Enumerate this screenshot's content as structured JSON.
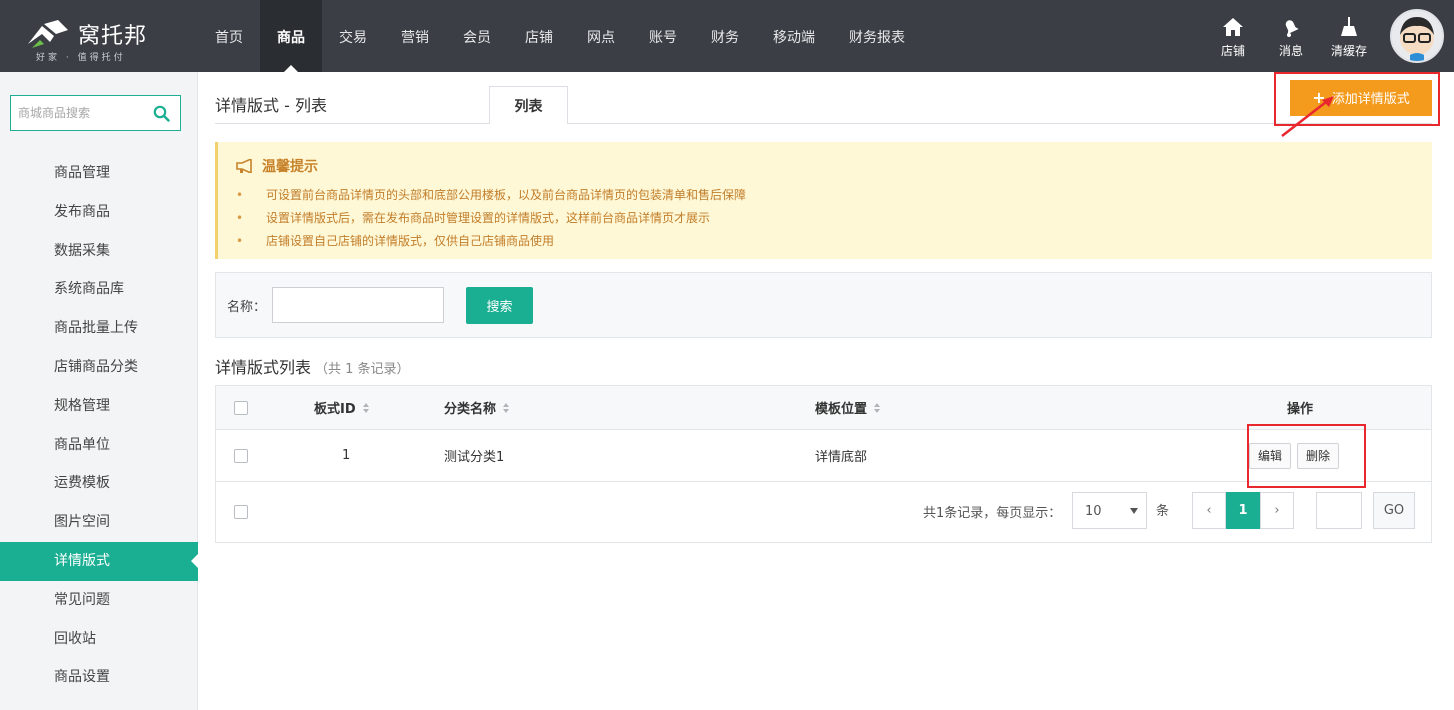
{
  "brand": {
    "name": "窝托邦",
    "tagline": "好家 · 值得托付",
    "colors": {
      "topbar": "#3b3f45",
      "accent": "#1aae92",
      "orange": "#f49a1c",
      "highlight": "#e8282d"
    }
  },
  "nav": {
    "items": [
      {
        "label": "首页",
        "active": false
      },
      {
        "label": "商品",
        "active": true
      },
      {
        "label": "交易",
        "active": false
      },
      {
        "label": "营销",
        "active": false
      },
      {
        "label": "会员",
        "active": false
      },
      {
        "label": "店铺",
        "active": false
      },
      {
        "label": "网点",
        "active": false
      },
      {
        "label": "账号",
        "active": false
      },
      {
        "label": "财务",
        "active": false
      },
      {
        "label": "移动端",
        "active": false
      },
      {
        "label": "财务报表",
        "active": false
      }
    ],
    "tools": [
      {
        "label": "店铺",
        "icon": "home-icon"
      },
      {
        "label": "消息",
        "icon": "bell-icon"
      },
      {
        "label": "清缓存",
        "icon": "broom-icon"
      }
    ]
  },
  "sidebar": {
    "search_placeholder": "商城商品搜索",
    "items": [
      {
        "label": "商品管理",
        "active": false
      },
      {
        "label": "发布商品",
        "active": false
      },
      {
        "label": "数据采集",
        "active": false
      },
      {
        "label": "系统商品库",
        "active": false
      },
      {
        "label": "商品批量上传",
        "active": false
      },
      {
        "label": "店铺商品分类",
        "active": false
      },
      {
        "label": "规格管理",
        "active": false
      },
      {
        "label": "商品单位",
        "active": false
      },
      {
        "label": "运费模板",
        "active": false
      },
      {
        "label": "图片空间",
        "active": false
      },
      {
        "label": "详情版式",
        "active": true
      },
      {
        "label": "常见问题",
        "active": false
      },
      {
        "label": "回收站",
        "active": false
      },
      {
        "label": "商品设置",
        "active": false
      }
    ]
  },
  "page": {
    "title": "详情版式 - 列表",
    "tab_label": "列表",
    "add_button_label": "添加详情版式"
  },
  "tips": {
    "title": "温馨提示",
    "items": [
      "可设置前台商品详情页的头部和底部公用楼板，以及前台商品详情页的包装清单和售后保障",
      "设置详情版式后，需在发布商品时管理设置的详情版式，这样前台商品详情页才展示",
      "店铺设置自己店铺的详情版式，仅供自己店铺商品使用"
    ]
  },
  "filter": {
    "name_label": "名称：",
    "name_value": "",
    "search_label": "搜索"
  },
  "list": {
    "title": "详情版式列表",
    "count_text": "（共 1 条记录）",
    "columns": [
      "板式ID",
      "分类名称",
      "模板位置",
      "操作"
    ],
    "rows": [
      {
        "id": "1",
        "category": "测试分类1",
        "position": "详情底部",
        "edit_label": "编辑",
        "delete_label": "删除"
      }
    ]
  },
  "pager": {
    "summary": "共1条记录，每页显示：",
    "page_size": "10",
    "unit": "条",
    "prev": "‹",
    "current": "1",
    "next": "›",
    "go_value": "",
    "go_label": "GO"
  }
}
